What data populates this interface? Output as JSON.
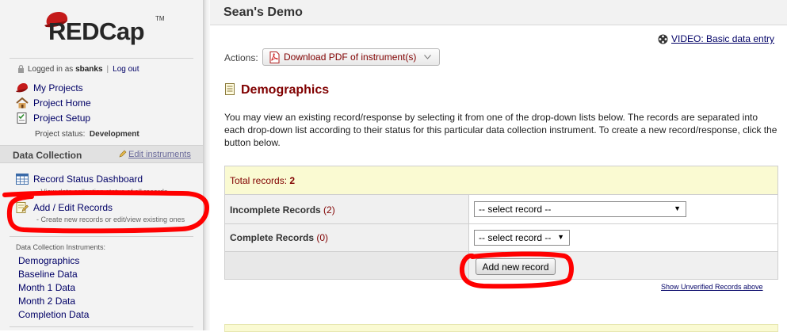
{
  "sidebar": {
    "logo": "REDCap",
    "logo_tm": "TM",
    "login_prefix": "Logged in as",
    "username": "sbanks",
    "logout": "Log out",
    "nav": [
      {
        "label": "My Projects",
        "icon": "red-hat-icon"
      },
      {
        "label": "Project Home",
        "icon": "home-icon"
      },
      {
        "label": "Project Setup",
        "icon": "checklist-icon"
      }
    ],
    "project_status_label": "Project status:",
    "project_status_value": "Development",
    "section_title": "Data Collection",
    "edit_instruments": "Edit instruments",
    "record_status_dashboard": "Record Status Dashboard",
    "record_status_desc": "- View data collection status of all records",
    "add_edit_records": "Add / Edit Records",
    "add_edit_desc": "- Create new records or edit/view existing ones",
    "instruments_title": "Data Collection Instruments:",
    "instruments": [
      "Demographics",
      "Baseline Data",
      "Month 1 Data",
      "Month 2 Data",
      "Completion Data"
    ]
  },
  "main": {
    "project_title": "Sean's Demo",
    "video_link": "VIDEO: Basic data entry",
    "actions_label": "Actions:",
    "download_pdf": "Download PDF of instrument(s)",
    "instrument_heading": "Demographics",
    "intro": "You may view an existing record/response by selecting it from one of the drop-down lists below. The records are separated into each drop-down list according to their status for this particular data collection instrument. To create a new record/response, click the button below.",
    "total_label": "Total records:",
    "total_value": "2",
    "incomplete_label": "Incomplete Records",
    "incomplete_count": "(2)",
    "incomplete_select": "-- select record --",
    "complete_label": "Complete Records",
    "complete_count": "(0)",
    "complete_select": "-- select record --",
    "add_new_record": "Add new record",
    "show_unverified": "Show Unverified Records above"
  },
  "colors": {
    "annotation": "#ff0000",
    "dark_red": "#800000",
    "link_blue": "#000066",
    "total_bg": "#fafad2"
  }
}
